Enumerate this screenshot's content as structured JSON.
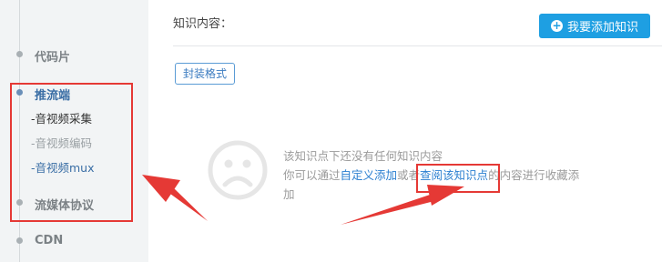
{
  "sidebar": {
    "items": [
      {
        "label": "代码片"
      },
      {
        "label": "推流端",
        "children": [
          "-音视频采集",
          "-音视频编码",
          "-音视频mux"
        ]
      },
      {
        "label": "流媒体协议"
      },
      {
        "label": "CDN"
      }
    ]
  },
  "main": {
    "section_label": "知识内容：",
    "add_button_label": "我要添加知识",
    "tag_button_label": "封装格式",
    "empty": {
      "line1": "该知识点下还没有任何知识内容",
      "line2_prefix": "你可以通过",
      "link_custom": "自定义添加",
      "line2_or": "或者",
      "link_browse": "查阅该知识点",
      "line2_suffix": "的内容进行收藏添",
      "line3": "加",
      "icon": "sad-face-icon"
    }
  },
  "colors": {
    "accent": "#1e9fe2",
    "link": "#2b7fd0",
    "annotation": "#e53935",
    "sidebar_bg": "#f2f4f5"
  }
}
